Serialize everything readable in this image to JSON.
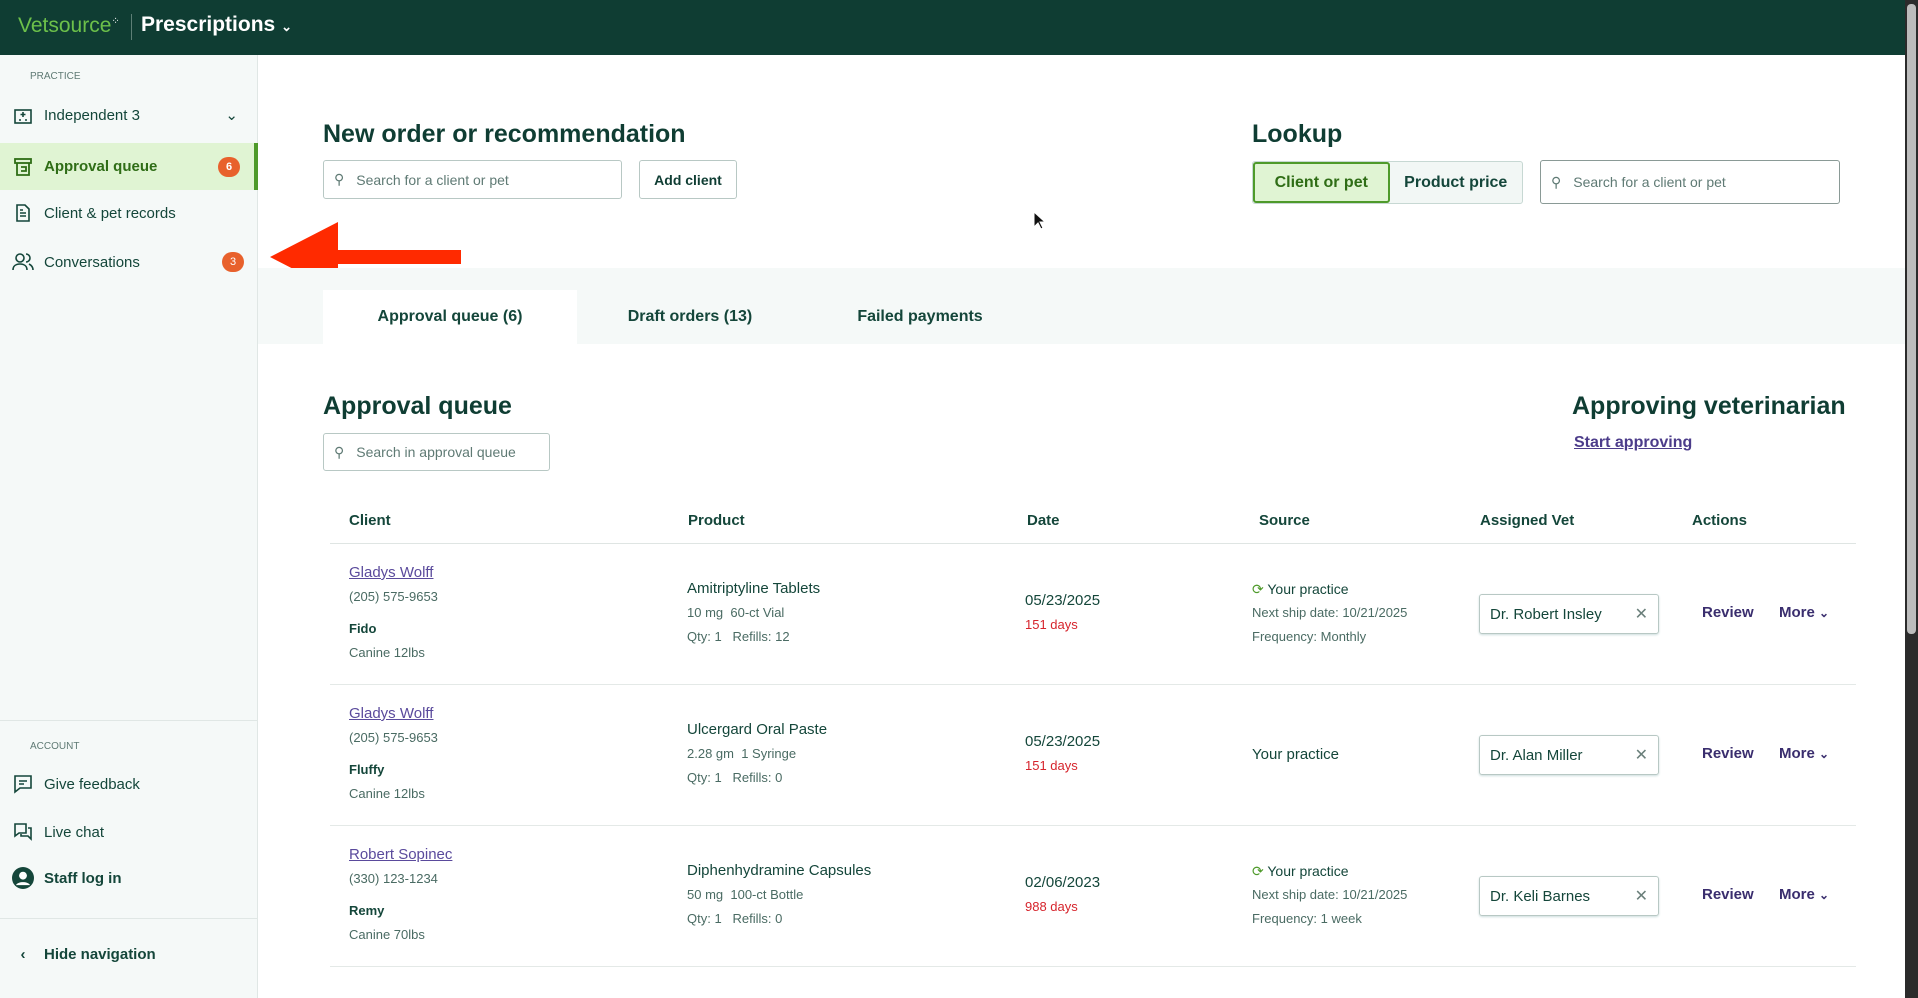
{
  "header": {
    "logo": "Vetsource",
    "app_title": "Prescriptions"
  },
  "sidebar": {
    "practice_label": "PRACTICE",
    "practice": "Independent 3",
    "items": [
      {
        "label": "Approval queue",
        "badge": "6"
      },
      {
        "label": "Client & pet records"
      },
      {
        "label": "Conversations",
        "badge": "3"
      }
    ],
    "account_label": "ACCOUNT",
    "account_items": [
      {
        "label": "Give feedback"
      },
      {
        "label": "Live chat"
      },
      {
        "label": "Staff log in"
      }
    ],
    "hide_nav": "Hide navigation"
  },
  "new_order": {
    "title": "New order or recommendation",
    "search_placeholder": "Search for a client or pet",
    "add_client": "Add client"
  },
  "lookup": {
    "title": "Lookup",
    "options": [
      "Client or pet",
      "Product price"
    ],
    "selected": "Client or pet",
    "search_placeholder": "Search for a client or pet"
  },
  "tabs": [
    "Approval queue (6)",
    "Draft orders (13)",
    "Failed payments"
  ],
  "queue": {
    "title": "Approval queue",
    "search_placeholder": "Search in approval queue",
    "approving_title": "Approving veterinarian",
    "start_link": "Start approving",
    "columns": [
      "Client",
      "Product",
      "Date",
      "Source",
      "Assigned Vet",
      "Actions"
    ],
    "rows": [
      {
        "client": "Gladys Wolff",
        "phone": "(205) 575-9653",
        "pet": "Fido",
        "pet_info": "Canine 12lbs",
        "product": "Amitriptyline Tablets",
        "dose": "10 mg  60-ct Vial",
        "qty": "Qty: 1   Refills: 12",
        "date": "05/23/2025",
        "age": "151 days",
        "source": "Your practice",
        "autoship": true,
        "next_ship": "Next ship date: 10/21/2025",
        "frequency": "Frequency: Monthly",
        "vet": "Dr. Robert Insley",
        "review": "Review",
        "more": "More"
      },
      {
        "client": "Gladys Wolff",
        "phone": "(205) 575-9653",
        "pet": "Fluffy",
        "pet_info": "Canine 12lbs",
        "product": "Ulcergard Oral Paste",
        "dose": "2.28 gm  1 Syringe",
        "qty": "Qty: 1   Refills: 0",
        "date": "05/23/2025",
        "age": "151 days",
        "source": "Your practice",
        "autoship": false,
        "vet": "Dr. Alan Miller",
        "review": "Review",
        "more": "More"
      },
      {
        "client": "Robert Sopinec",
        "phone": "(330) 123-1234",
        "pet": "Remy",
        "pet_info": "Canine 70lbs",
        "product": "Diphenhydramine Capsules",
        "dose": "50 mg  100-ct Bottle",
        "qty": "Qty: 1   Refills: 0",
        "date": "02/06/2023",
        "age": "988 days",
        "source": "Your practice",
        "autoship": true,
        "next_ship": "Next ship date: 10/21/2025",
        "frequency": "Frequency: 1 week",
        "vet": "Dr. Keli Barnes",
        "review": "Review",
        "more": "More"
      }
    ]
  },
  "colors": {
    "topbar": "#0f3d33",
    "accent": "#4e9a2a",
    "badge": "#e8612c",
    "annotation_arrow": "#ff2a00"
  }
}
